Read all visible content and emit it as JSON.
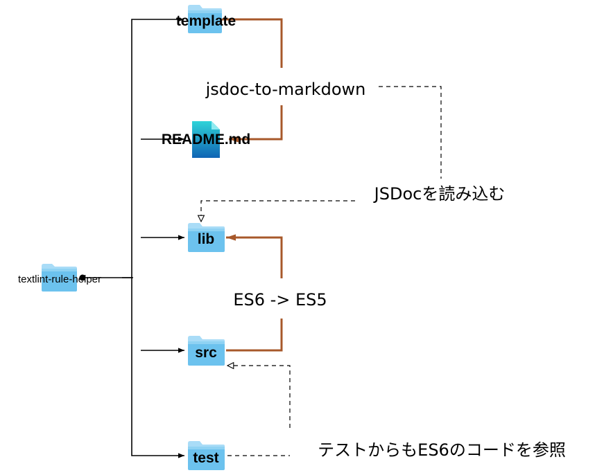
{
  "root": {
    "label": "textlint-rule-helper"
  },
  "nodes": {
    "template": {
      "label": "template",
      "type": "folder"
    },
    "readme": {
      "label": "README.md",
      "type": "file"
    },
    "lib": {
      "label": "lib",
      "type": "folder"
    },
    "src": {
      "label": "src",
      "type": "folder"
    },
    "test": {
      "label": "test",
      "type": "folder"
    }
  },
  "edges": {
    "jsdoc_to_markdown": "jsdoc-to-markdown",
    "jsdoc_read": "JSDocを読み込む",
    "es6_to_es5": "ES6 -> ES5",
    "test_refs_src": "テストからもES6のコードを参照"
  },
  "colors": {
    "folder_top": "#a9dcf7",
    "folder_body": "#6cc2ee",
    "file_top": "#2fd3d8",
    "file_bottom": "#1064b4",
    "transform_line": "#a7582a",
    "tree_line": "#000000",
    "dashed_line": "#000000"
  },
  "icons": {
    "folder": "folder-icon",
    "file": "document-icon"
  }
}
